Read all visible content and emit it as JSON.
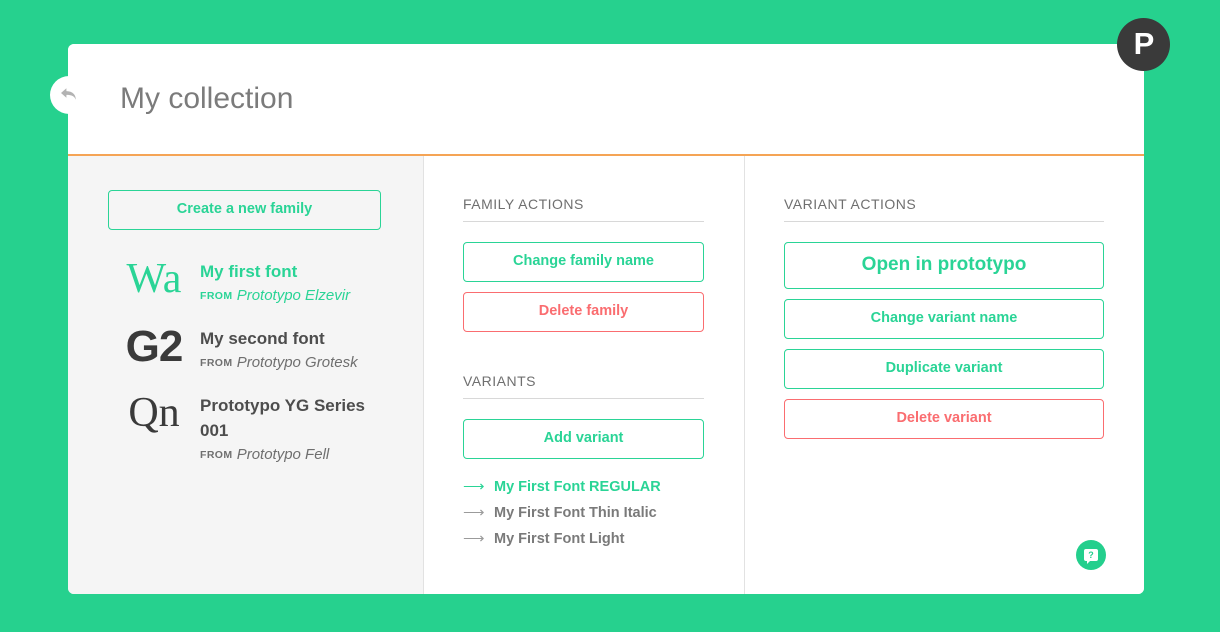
{
  "theme": {
    "background_green": "#26d18e",
    "accent_green": "#2ad496",
    "danger_red": "#fa6d70",
    "header_rule_orange": "#f5a455",
    "logo_dark": "#3a3a3a"
  },
  "logo": {
    "letter": "P",
    "name": "prototypo-logo-icon"
  },
  "back_button": {
    "name": "back-arrow-icon"
  },
  "header": {
    "title": "My collection"
  },
  "families_panel": {
    "create_button": "Create a new family",
    "items": [
      {
        "preview": "Wa",
        "preview_style": "serif",
        "name": "My first font",
        "from_label": "FROM",
        "from_value": "Prototypo Elzevir",
        "active": true
      },
      {
        "preview": "G2",
        "preview_style": "sans",
        "name": "My second font",
        "from_label": "FROM",
        "from_value": "Prototypo Grotesk",
        "active": false
      },
      {
        "preview": "Qn",
        "preview_style": "serif",
        "name": "Prototypo YG Series 001",
        "from_label": "FROM",
        "from_value": "Prototypo Fell",
        "active": false
      }
    ]
  },
  "family_actions": {
    "section_title": "FAMILY ACTIONS",
    "change_name_button": "Change family name",
    "delete_button": "Delete family"
  },
  "variants": {
    "section_title": "VARIANTS",
    "add_button": "Add variant",
    "arrow_glyph": "⟶",
    "items": [
      {
        "label": "My First Font REGULAR",
        "active": true
      },
      {
        "label": "My First Font Thin Italic",
        "active": false
      },
      {
        "label": "My First Font Light",
        "active": false
      }
    ]
  },
  "variant_actions": {
    "section_title": "VARIANT ACTIONS",
    "open_button": "Open in prototypo",
    "change_name_button": "Change variant name",
    "duplicate_button": "Duplicate variant",
    "delete_button": "Delete variant"
  },
  "help_button": {
    "name": "help-chat-icon",
    "glyph": "?"
  }
}
